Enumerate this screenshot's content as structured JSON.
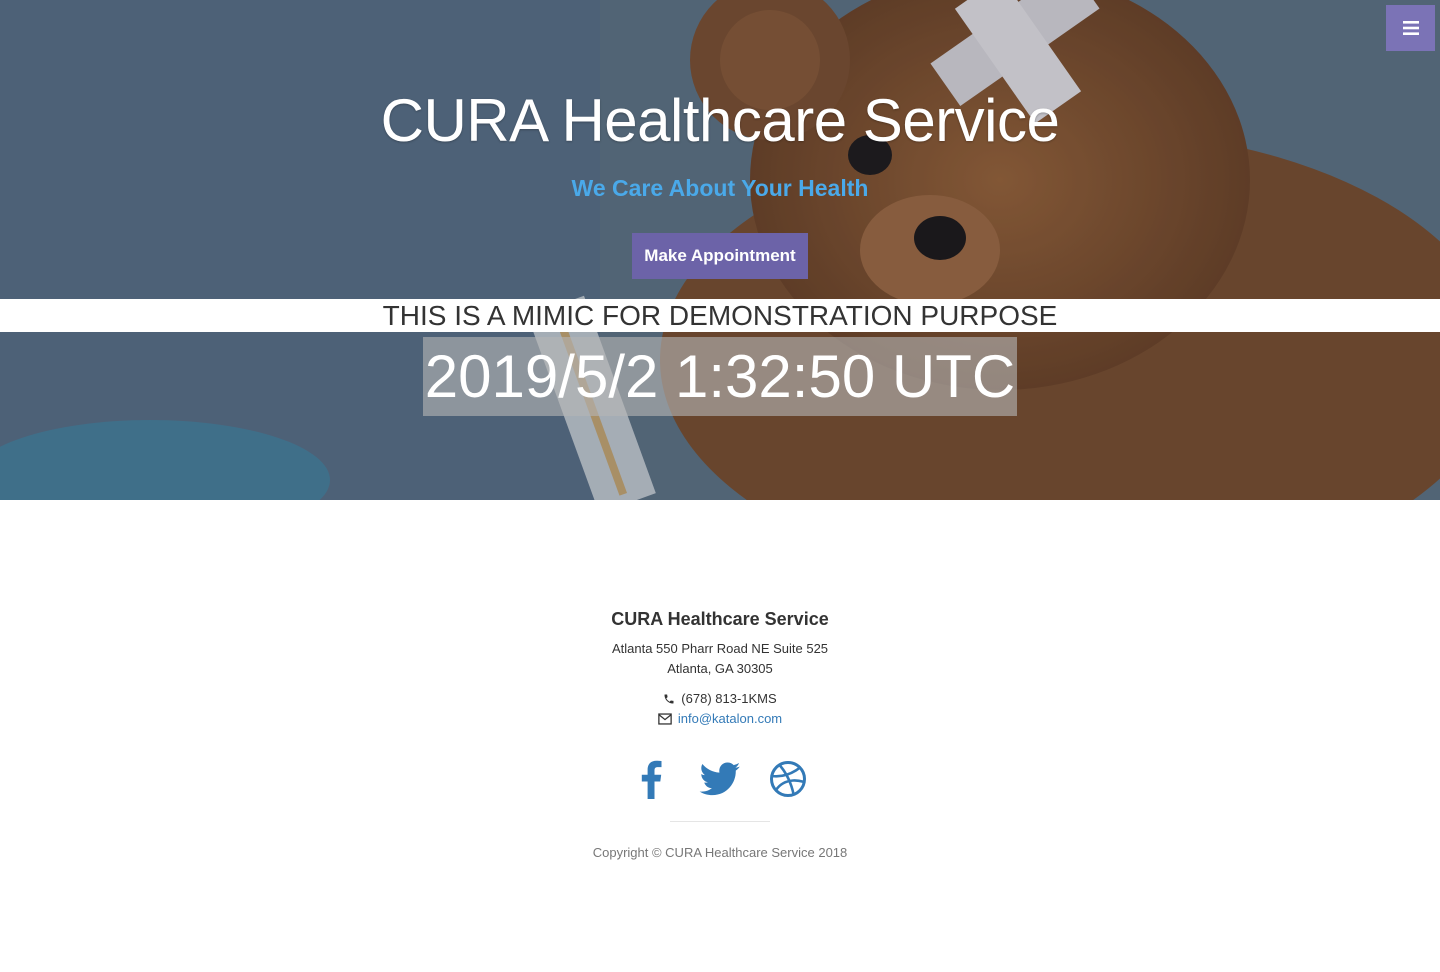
{
  "hero": {
    "title": "CURA Healthcare Service",
    "subtitle": "We Care About Your Health",
    "appointment_button": "Make Appointment",
    "menu_icon": "hamburger-menu-icon"
  },
  "banner": {
    "notice": "THIS IS A MIMIC FOR DEMONSTRATION PURPOSE",
    "timestamp": "2019/5/2 1:32:50 UTC"
  },
  "footer": {
    "title": "CURA Healthcare Service",
    "address_line1": "Atlanta 550 Pharr Road NE Suite 525",
    "address_line2": "Atlanta, GA 30305",
    "phone": "(678) 813-1KMS",
    "email": "info@katalon.com",
    "social": [
      "facebook-icon",
      "twitter-icon",
      "dribbble-icon"
    ],
    "copyright": "Copyright © CURA Healthcare Service 2018"
  },
  "colors": {
    "accent": "#6c63a8",
    "menu": "#7b73b6",
    "subtitle": "#4aa9e9",
    "social": "#337ab7"
  }
}
